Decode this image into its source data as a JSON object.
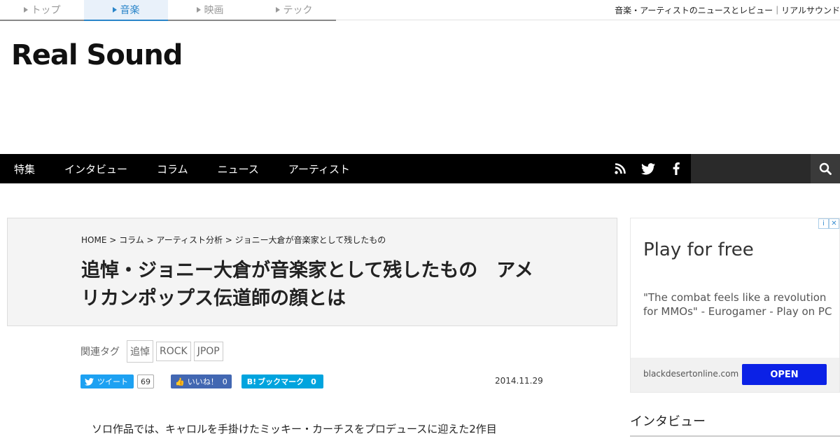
{
  "top": {
    "tabs": [
      {
        "label": "トップ",
        "active": false
      },
      {
        "label": "音楽",
        "active": true
      },
      {
        "label": "映画",
        "active": false
      },
      {
        "label": "テック",
        "active": false
      }
    ],
    "tagline": "音楽・アーティストのニュースとレビュー｜リアルサウンド"
  },
  "logo": "Real Sound",
  "nav": {
    "items": [
      "特集",
      "インタビュー",
      "コラム",
      "ニュース",
      "アーティスト"
    ],
    "icons": [
      "rss-icon",
      "twitter-icon",
      "facebook-icon"
    ],
    "search_icon": "search-icon"
  },
  "article": {
    "breadcrumb": "HOME > コラム > アーティスト分析 > ジョニー大倉が音楽家として残したもの",
    "headline": "追悼・ジョニー大倉が音楽家として残したもの　アメリカンポップス伝道師の顔とは",
    "tags_label": "関連タグ",
    "tags": [
      "追悼",
      "ROCK",
      "JPOP"
    ],
    "tweet_label": "ツイート",
    "tweet_count": "69",
    "like_label": "いいね！",
    "like_count": "0",
    "bookmark_label": "ブックマーク",
    "bookmark_count": "0",
    "date": "2014.11.29",
    "body_first_line": "ソロ作品では、キャロルを手掛けたミッキー・カーチスをプロデュースに迎えた2作目"
  },
  "ad": {
    "title": "Play for free",
    "description": "\"The combat feels like a revolution for MMOs\" - Eurogamer - Play on PC",
    "domain": "blackdesertonline.com",
    "cta": "OPEN"
  },
  "sidebar": {
    "heading": "インタビュー"
  },
  "colors": {
    "accent": "#2a85c9",
    "nav_bg": "#000000",
    "twitter": "#1da1f2",
    "facebook": "#4267b2",
    "hatena": "#00a4de",
    "ad_button": "#0b21e6"
  }
}
